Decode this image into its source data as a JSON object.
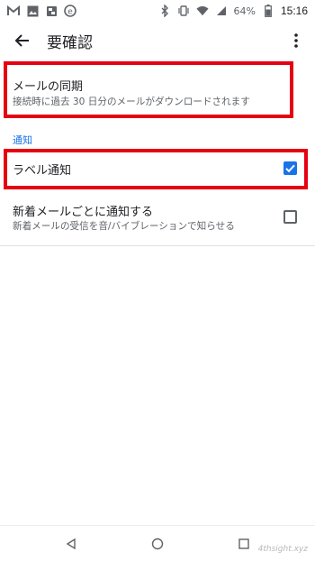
{
  "status_bar": {
    "battery_percent": "64%",
    "time": "15:16",
    "left_icons": [
      "gmail-icon",
      "image-icon",
      "folder-icon",
      "e-circle-icon"
    ],
    "right_icons": [
      "bluetooth-icon",
      "vibrate-icon",
      "wifi-icon",
      "signal-icon",
      "battery-icon"
    ]
  },
  "app_bar": {
    "title": "要確認"
  },
  "settings": {
    "sync": {
      "title": "メールの同期",
      "subtitle": "接続時に過去 30 日分のメールがダウンロードされます"
    },
    "section_header": "通知",
    "label_notification": {
      "title": "ラベル通知",
      "checked": true
    },
    "new_mail_notification": {
      "title": "新着メールごとに通知する",
      "subtitle": "新着メールの受信を音/バイブレーションで知らせる",
      "checked": false
    }
  },
  "colors": {
    "accent": "#1a73e8",
    "highlight": "#e60012"
  },
  "watermark": "4thsight.xyz"
}
